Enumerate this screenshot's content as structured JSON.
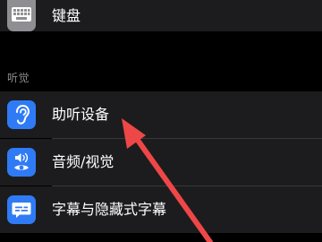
{
  "settings": {
    "top_row": {
      "label": "键盘",
      "icon": "keyboard-icon",
      "icon_bg": "#8e8e93"
    },
    "section_header": "听觉",
    "items": [
      {
        "label": "助听设备",
        "icon": "ear-icon",
        "icon_bg": "#2f7bf5"
      },
      {
        "label": "音频/视觉",
        "icon": "speaker-eye-icon",
        "icon_bg": "#2f7bf5"
      },
      {
        "label": "字幕与隐藏式字幕",
        "icon": "subtitles-icon",
        "icon_bg": "#2f7bf5"
      }
    ]
  },
  "annotation": {
    "type": "arrow",
    "color": "#ee4747",
    "points_to": "助听设备"
  },
  "colors": {
    "background": "#000000",
    "row_background": "#1c1c1e",
    "separator": "#38383a",
    "section_header_text": "#8e8e93",
    "row_text": "#ffffff",
    "icon_blue": "#2f7bf5",
    "icon_gray": "#8e8e93"
  }
}
